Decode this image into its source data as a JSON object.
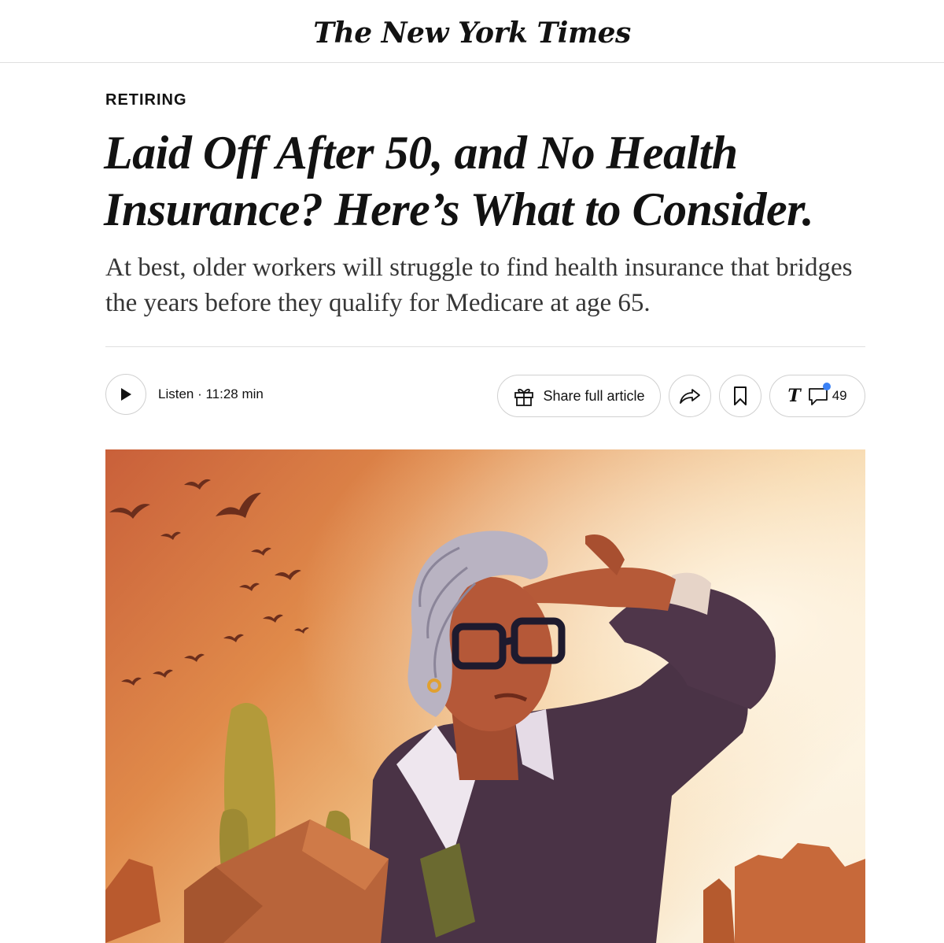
{
  "masthead": {
    "logo_text": "The New York Times"
  },
  "article": {
    "kicker": "RETIRING",
    "headline": "Laid Off After 50, and No Health Insurance? Here’s What to Consider.",
    "summary": "At best, older workers will struggle to find health insurance that bridges the years before they qualify for Medicare at age 65."
  },
  "toolbar": {
    "listen_label": "Listen · 11:28 min",
    "share_label": "Share full article",
    "comment_count": "49",
    "t_logo": "T"
  },
  "icons": {
    "play": "play-icon",
    "gift": "gift-icon",
    "forward": "forward-arrow-icon",
    "bookmark": "bookmark-icon",
    "comment": "comment-icon"
  },
  "colors": {
    "text": "#121212",
    "summary_text": "#363636",
    "rule": "#dfdfdf",
    "notification": "#3b82f6"
  }
}
